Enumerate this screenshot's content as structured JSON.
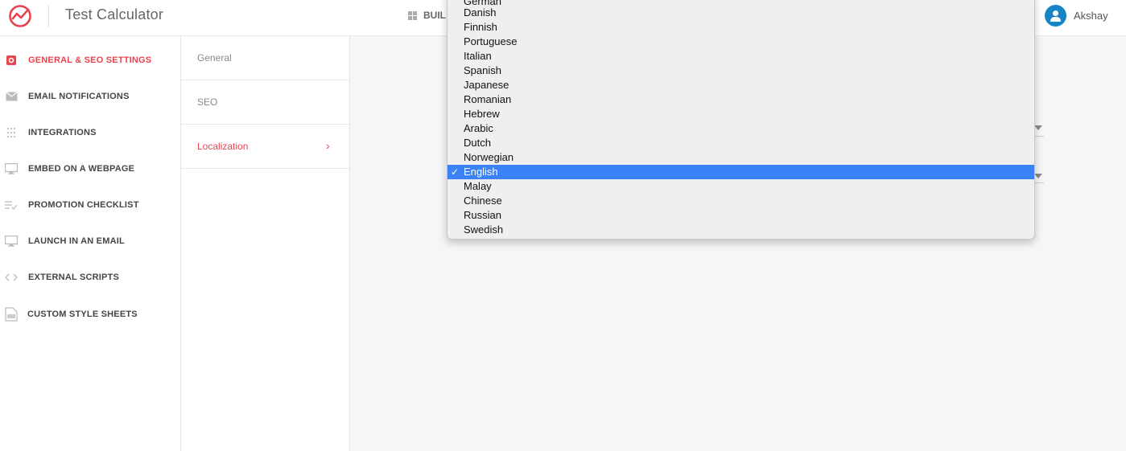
{
  "header": {
    "app_title": "Test Calculator",
    "builder_tab": "BUIL",
    "user_name": "Akshay",
    "brand_color": "#e8434f"
  },
  "sidebar": {
    "items": [
      {
        "label": "GENERAL & SEO SETTINGS",
        "icon": "gear-icon",
        "active": true
      },
      {
        "label": "EMAIL NOTIFICATIONS",
        "icon": "envelope-icon",
        "active": false
      },
      {
        "label": "INTEGRATIONS",
        "icon": "dots-grid-icon",
        "active": false
      },
      {
        "label": "EMBED ON A WEBPAGE",
        "icon": "monitor-icon",
        "active": false
      },
      {
        "label": "PROMOTION CHECKLIST",
        "icon": "checklist-icon",
        "active": false
      },
      {
        "label": "LAUNCH IN AN EMAIL",
        "icon": "monitor-icon",
        "active": false
      },
      {
        "label": "EXTERNAL SCRIPTS",
        "icon": "code-icon",
        "active": false
      },
      {
        "label": "CUSTOM STYLE SHEETS",
        "icon": "css-file-icon",
        "active": false
      }
    ]
  },
  "subnav": {
    "items": [
      {
        "label": "General",
        "active": false
      },
      {
        "label": "SEO",
        "active": false
      },
      {
        "label": "Localization",
        "active": true,
        "chevron": "›"
      }
    ]
  },
  "language_dropdown": {
    "options": [
      "German",
      "Danish",
      "Finnish",
      "Portuguese",
      "Italian",
      "Spanish",
      "Japanese",
      "Romanian",
      "Hebrew",
      "Arabic",
      "Dutch",
      "Norwegian",
      "English",
      "Malay",
      "Chinese",
      "Russian",
      "Swedish"
    ],
    "selected": "English",
    "check_mark": "✓",
    "selected_color": "#3b82f6"
  }
}
